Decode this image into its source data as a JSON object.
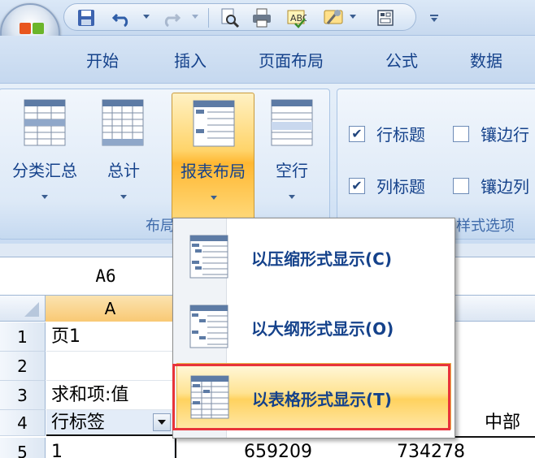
{
  "quick_access": {
    "icons": [
      "save-icon",
      "undo-icon",
      "redo-icon",
      "print-preview-icon",
      "print-icon",
      "spelling-icon",
      "tools-icon",
      "form-icon",
      "customize-arrow-icon"
    ]
  },
  "tabs": [
    "开始",
    "插入",
    "页面布局",
    "公式",
    "数据"
  ],
  "ribbon": {
    "layout_buttons": [
      {
        "label": "分类汇总"
      },
      {
        "label": "总计"
      },
      {
        "label": "报表布局"
      },
      {
        "label": "空行"
      }
    ],
    "layout_group_label": "布局",
    "style_options": [
      {
        "label": "行标题",
        "checked": true
      },
      {
        "label": "镶边行",
        "checked": false
      },
      {
        "label": "列标题",
        "checked": true
      },
      {
        "label": "镶边列",
        "checked": false
      }
    ],
    "style_group_label": "样式选项"
  },
  "formula_bar": {
    "name_box": "A6"
  },
  "grid": {
    "col_header": "A",
    "rows": [
      {
        "num": "1",
        "a": "页1"
      },
      {
        "num": "2",
        "a": ""
      },
      {
        "num": "3",
        "a": "求和项:值"
      },
      {
        "num": "4",
        "a": "行标签"
      },
      {
        "num": "5",
        "a": "1"
      }
    ],
    "row4_right": "中部",
    "row5_values": [
      "659209",
      "734278"
    ]
  },
  "report_layout_menu": {
    "items": [
      {
        "label": "以压缩形式显示(C)"
      },
      {
        "label": "以大纲形式显示(O)"
      },
      {
        "label": "以表格形式显示(T)"
      }
    ],
    "selected_index": 2
  }
}
